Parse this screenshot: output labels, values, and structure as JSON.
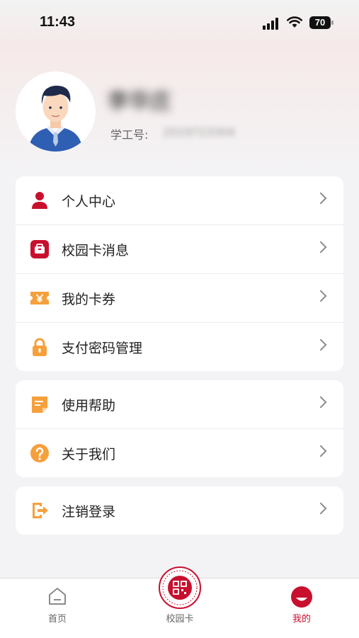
{
  "status_bar": {
    "time": "11:43",
    "battery": "70"
  },
  "profile": {
    "name": "李华庄",
    "id_label": "学工号:",
    "id_value": "2019723304"
  },
  "menu_group_1": [
    {
      "label": "个人中心",
      "icon": "person-icon"
    },
    {
      "label": "校园卡消息",
      "icon": "card-message-icon"
    },
    {
      "label": "我的卡券",
      "icon": "coupon-icon"
    },
    {
      "label": "支付密码管理",
      "icon": "lock-icon"
    }
  ],
  "menu_group_2": [
    {
      "label": "使用帮助",
      "icon": "help-doc-icon"
    },
    {
      "label": "关于我们",
      "icon": "question-icon"
    }
  ],
  "menu_group_3": [
    {
      "label": "注销登录",
      "icon": "logout-icon"
    }
  ],
  "tab_bar": {
    "home": "首页",
    "campus_card": "校园卡",
    "mine": "我的",
    "active": "mine"
  },
  "colors": {
    "accent": "#c8102e",
    "orange": "#f5a03c"
  }
}
